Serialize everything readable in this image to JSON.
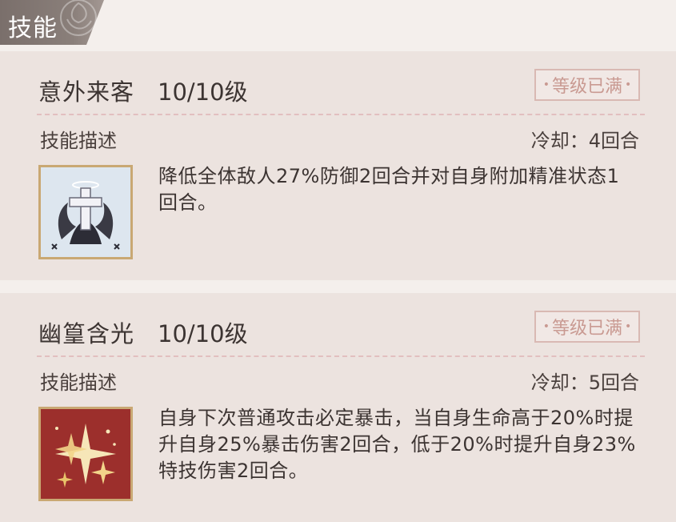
{
  "header": {
    "title": "技能"
  },
  "skills": [
    {
      "name": "意外来客",
      "level": "10/10级",
      "badge": "等级已满",
      "desc_label": "技能描述",
      "cooldown": "冷却：4回合",
      "description": "降低全体敌人27%防御2回合并对自身附加精准状态1回合。",
      "icon": "ghost-cross-icon"
    },
    {
      "name": "幽篁含光",
      "level": "10/10级",
      "badge": "等级已满",
      "desc_label": "技能描述",
      "cooldown": "冷却：5回合",
      "description": "自身下次普通攻击必定暴击，当自身生命高于20%时提升自身25%暴击伤害2回合，低于20%时提升自身23%特技伤害2回合。",
      "icon": "sparkle-burst-icon"
    }
  ],
  "colors": {
    "accent": "#c99a92",
    "frame": "#c9a873",
    "header": "#7a6f6b"
  }
}
